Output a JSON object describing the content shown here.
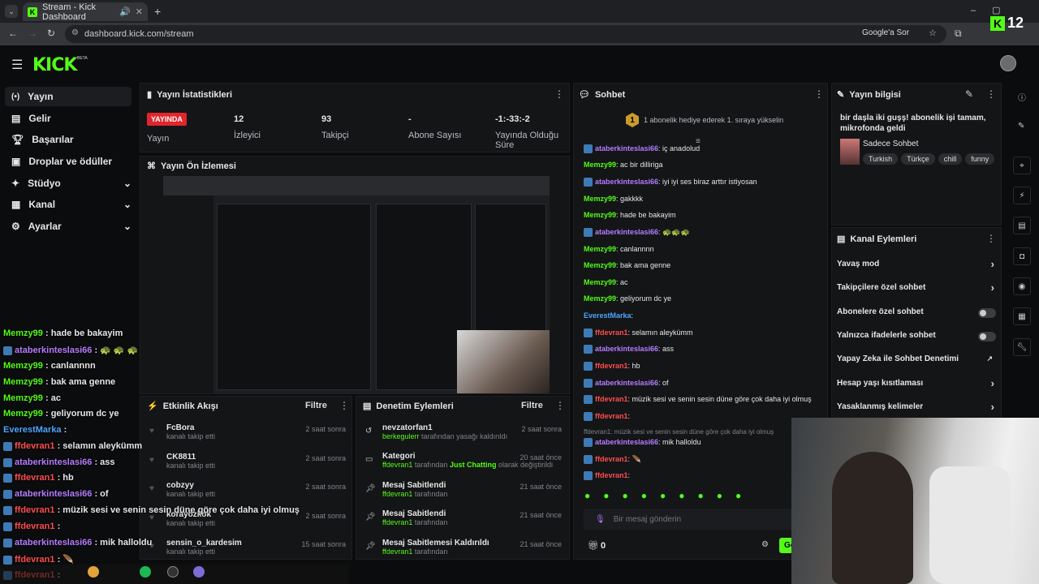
{
  "browser": {
    "tab_title": "Stream - Kick Dashboard",
    "url": "dashboard.kick.com/stream",
    "google_button": "Google'a Sor",
    "viewer_badge": "12"
  },
  "brand": {
    "logo": "KICK",
    "beta": "BETA"
  },
  "sidebar": {
    "items": [
      {
        "label": "Yayın"
      },
      {
        "label": "Gelir"
      },
      {
        "label": "Başarılar"
      },
      {
        "label": "Droplar ve ödüller"
      },
      {
        "label": "Stüdyo"
      },
      {
        "label": "Kanal"
      },
      {
        "label": "Ayarlar"
      }
    ]
  },
  "stats": {
    "title": "Yayın İstatistikleri",
    "live_badge": "YAYINDA",
    "live_label": "Yayın",
    "viewers_value": "12",
    "viewers_label": "İzleyici",
    "followers_value": "93",
    "followers_label": "Takipçi",
    "subs_value": "-",
    "subs_label": "Abone Sayısı",
    "uptime_value": "-1:-33:-2",
    "uptime_label": "Yayında Olduğu Süre"
  },
  "preview": {
    "title": "Yayın Ön İzlemesi"
  },
  "activity": {
    "title": "Etkinlik Akışı",
    "filter": "Filtre",
    "items": [
      {
        "name": "FcBora",
        "sub": "kanalı takip etti",
        "time": "2 saat sonra"
      },
      {
        "name": "CK8811",
        "sub": "kanalı takip etti",
        "time": "2 saat sonra"
      },
      {
        "name": "cobzyy",
        "sub": "kanalı takip etti",
        "time": "2 saat sonra"
      },
      {
        "name": "korayozkok",
        "sub": "kanalı takip etti",
        "time": "2 saat sonra"
      },
      {
        "name": "sensin_o_kardesim",
        "sub": "kanalı takip etti",
        "time": "15 saat sonra"
      }
    ]
  },
  "moderation": {
    "title": "Denetim Eylemleri",
    "filter": "Filtre",
    "items": [
      {
        "title": "nevzatorfan1",
        "who": "berkegulerr",
        "rest": "tarafından yasağı kaldırıldı",
        "extra": "",
        "extra2": "",
        "time": "2 saat sonra"
      },
      {
        "title": "Kategori",
        "who": "ffdevran1",
        "rest": "tarafından",
        "extra": "Just Chatting",
        "extra2": "olarak değiştirildi",
        "time": "20 saat önce"
      },
      {
        "title": "Mesaj Sabitlendi",
        "who": "ffdevran1",
        "rest": "tarafından",
        "extra": "",
        "extra2": "",
        "time": "21 saat önce"
      },
      {
        "title": "Mesaj Sabitlendi",
        "who": "ffdevran1",
        "rest": "tarafından",
        "extra": "",
        "extra2": "",
        "time": "21 saat önce"
      },
      {
        "title": "Mesaj Sabitlemesi Kaldırıldı",
        "who": "ffdevran1",
        "rest": "tarafından",
        "extra": "",
        "extra2": "",
        "time": "21 saat önce"
      }
    ]
  },
  "chat": {
    "title": "Sohbet",
    "gift_rank": "1",
    "gift_text": "1 abonelik hediye ederek 1. sıraya yükselin",
    "input_placeholder": "Bir mesaj gönderin",
    "points": "0",
    "send": "Gö",
    "messages": [
      {
        "nick": "ataberkinteslasi66",
        "color": "p",
        "text": ": iç anadolud"
      },
      {
        "nick": "Memzy99",
        "color": "g",
        "text": ": ac bir dilliriga"
      },
      {
        "nick": "ataberkinteslasi66",
        "color": "p",
        "text": ": iyi iyi ses biraz arttır istiyosan"
      },
      {
        "nick": "Memzy99",
        "color": "g",
        "text": ": gakkkk"
      },
      {
        "nick": "Memzy99",
        "color": "g",
        "text": ": hade be bakayim"
      },
      {
        "nick": "ataberkinteslasi66",
        "color": "p",
        "text": ": 🐢🐢🐢"
      },
      {
        "nick": "Memzy99",
        "color": "g",
        "text": ": canlannnn"
      },
      {
        "nick": "Memzy99",
        "color": "g",
        "text": ": bak ama genne"
      },
      {
        "nick": "Memzy99",
        "color": "g",
        "text": ": ac"
      },
      {
        "nick": "Memzy99",
        "color": "g",
        "text": ": geliyorum dc ye"
      },
      {
        "nick": "EverestMarka",
        "color": "b",
        "text": ": "
      },
      {
        "nick": "ffdevran1",
        "color": "r",
        "text": ": selamın aleykümm"
      },
      {
        "nick": "ataberkinteslasi66",
        "color": "p",
        "text": ": ass"
      },
      {
        "nick": "ffdevran1",
        "color": "r",
        "text": ": hb"
      },
      {
        "nick": "ataberkinteslasi66",
        "color": "p",
        "text": ": of"
      },
      {
        "nick": "ffdevran1",
        "color": "r",
        "text": ": müzik sesi ve senin sesin düne göre çok daha iyi olmuş"
      },
      {
        "nick": "ffdevran1",
        "color": "r",
        "text": ": "
      },
      {
        "nick": "ataberkinteslasi66",
        "color": "p",
        "text": ": mik halloldu"
      },
      {
        "nick": "ffdevran1",
        "color": "r",
        "text": ": 🪶"
      },
      {
        "nick": "ffdevran1",
        "color": "r",
        "text": ": "
      }
    ],
    "reply_preview": "ffdevran1: müzik sesi ve senin sesin düne göre çok daha iyi olmuş"
  },
  "stream_info": {
    "title": "Yayın bilgisi",
    "stream_title": "bir daşla iki guşş! abonelik işi tamam, mikrofonda geldi",
    "category": "Sadece Sohbet",
    "tags": [
      "Turkish",
      "Türkçe",
      "chill",
      "funny"
    ]
  },
  "channel_actions": {
    "title": "Kanal Eylemleri",
    "items": [
      {
        "label": "Yavaş mod"
      },
      {
        "label": "Takipçilere özel sohbet"
      },
      {
        "label": "Abonelere özel sohbet"
      },
      {
        "label": "Yalnızca ifadelerle sohbet"
      },
      {
        "label": "Yapay Zeka ile Sohbet Denetimi"
      },
      {
        "label": "Hesap yaşı kısıtlaması"
      },
      {
        "label": "Yasaklanmış kelimeler"
      }
    ]
  },
  "overlay_chat": [
    {
      "nick": "Memzy99",
      "color": "g",
      "text": " : hade be bakayim"
    },
    {
      "nick": "ataberkinteslasi66",
      "color": "p",
      "text": " : 🐢 🐢 🐢"
    },
    {
      "nick": "Memzy99",
      "color": "g",
      "text": " : canlannnn"
    },
    {
      "nick": "Memzy99",
      "color": "g",
      "text": " : bak ama genne"
    },
    {
      "nick": "Memzy99",
      "color": "g",
      "text": " : ac"
    },
    {
      "nick": "Memzy99",
      "color": "g",
      "text": " : geliyorum dc ye"
    },
    {
      "nick": "EverestMarka",
      "color": "b",
      "text": " : "
    },
    {
      "nick": "ffdevran1",
      "color": "r",
      "text": " : selamın aleykümm"
    },
    {
      "nick": "ataberkinteslasi66",
      "color": "p",
      "text": " : ass"
    },
    {
      "nick": "ffdevran1",
      "color": "r",
      "text": " : hb"
    },
    {
      "nick": "ataberkinteslasi66",
      "color": "p",
      "text": " : of"
    },
    {
      "nick": "ffdevran1",
      "color": "r",
      "text": " : müzik sesi ve senin sesin düne göre çok daha iyi olmuş"
    },
    {
      "nick": "ffdevran1",
      "color": "r",
      "text": " : "
    },
    {
      "nick": "ataberkinteslasi66",
      "color": "p",
      "text": " : mik halloldu"
    },
    {
      "nick": "ffdevran1",
      "color": "r",
      "text": " : 🪶"
    },
    {
      "nick": "ffdevran1",
      "color": "r",
      "text": " : "
    }
  ],
  "colors": {
    "accent": "#53fc18",
    "live": "#e0262c",
    "nick_purple": "#b57cff",
    "nick_red": "#ff4d4d",
    "nick_green": "#53fc18",
    "nick_blue": "#4da6ff"
  }
}
